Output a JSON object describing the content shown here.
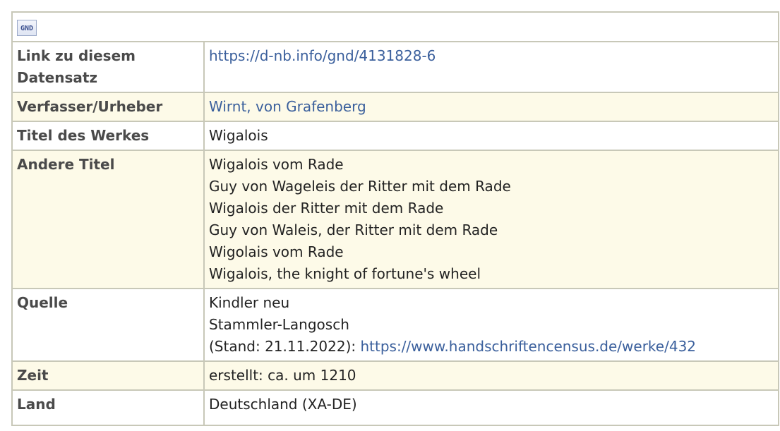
{
  "logo": {
    "text": "GND"
  },
  "rows": {
    "link": {
      "label": "Link zu diesem Datensatz",
      "url": "https://d-nb.info/gnd/4131828-6"
    },
    "author": {
      "label": "Verfasser/Urheber",
      "value": "Wirnt, von Grafenberg"
    },
    "title": {
      "label": "Titel des Werkes",
      "value": "Wigalois"
    },
    "other_titles": {
      "label": "Andere Titel",
      "values": [
        "Wigalois vom Rade",
        "Guy von Wageleis der Ritter mit dem Rade",
        "Wigalois der Ritter mit dem Rade",
        "Guy von Waleis, der Ritter mit dem Rade",
        "Wigolais vom Rade",
        "Wigalois, the knight of fortune's wheel"
      ]
    },
    "source": {
      "label": "Quelle",
      "line1": "Kindler neu",
      "line2": "Stammler-Langosch",
      "line3_prefix": "(Stand: 21.11.2022): ",
      "line3_link": "https://www.handschriftencensus.de/werke/432"
    },
    "time": {
      "label": "Zeit",
      "value": "erstellt: ca. um 1210"
    },
    "country": {
      "label": "Land",
      "value": "Deutschland (XA-DE)"
    }
  }
}
